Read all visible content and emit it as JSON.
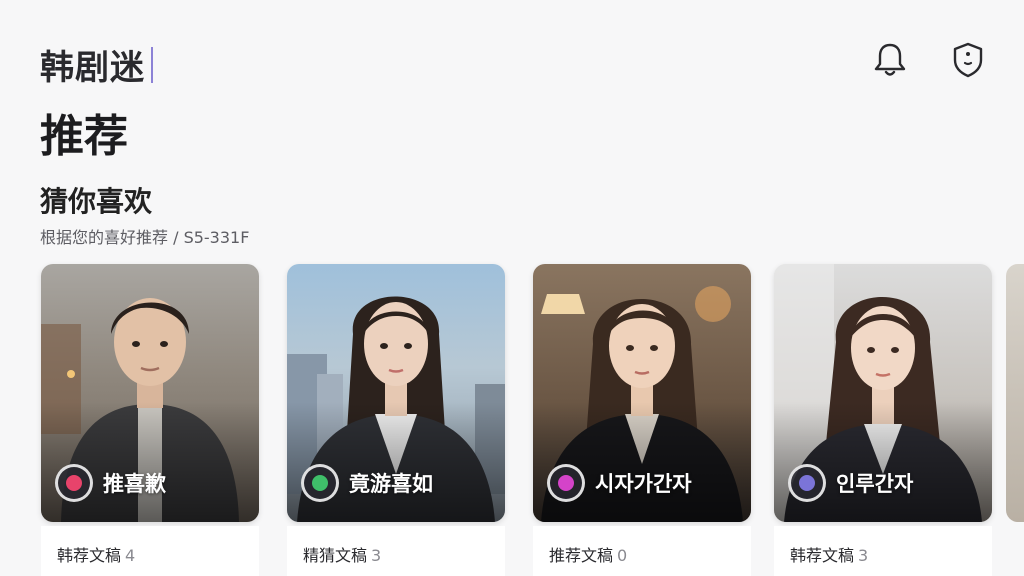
{
  "header": {
    "app_title": "韩剧迷",
    "page_title": "推荐",
    "icons": [
      "bell-icon",
      "shield-icon"
    ]
  },
  "section": {
    "title": "猜你喜欢",
    "subtitle": "根据您的喜好推荐 / S5-331F"
  },
  "cards": [
    {
      "name": "推喜歉",
      "meta_label": "韩荐文稿",
      "meta_count": "4",
      "badge_color": "#e8436b"
    },
    {
      "name": "竟游喜如",
      "meta_label": "精猜文稿",
      "meta_count": "3",
      "badge_color": "#3fbf6a"
    },
    {
      "name": "시자가간자",
      "meta_label": "推荐文稿",
      "meta_count": "0",
      "badge_color": "#d443c9"
    },
    {
      "name": "인루간자",
      "meta_label": "韩荐文稿",
      "meta_count": "3",
      "badge_color": "#7b74d8"
    }
  ],
  "colors": {
    "accent": "#8c82d6",
    "text_dark": "#1f1f22",
    "text_muted": "#8a8a90"
  }
}
